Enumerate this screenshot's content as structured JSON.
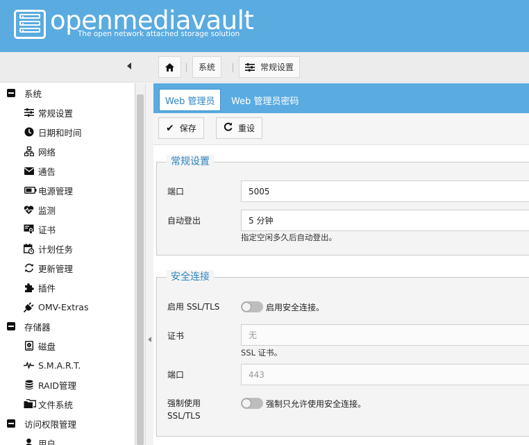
{
  "brand": {
    "name": "openmediavault",
    "tagline": "The open network attached storage solution"
  },
  "breadcrumb": {
    "items": [
      "系统",
      "常规设置"
    ]
  },
  "sidebar": {
    "groups": [
      {
        "label": "系统",
        "items": [
          {
            "label": "常规设置",
            "icon": "sliders-icon"
          },
          {
            "label": "日期和时间",
            "icon": "clock-icon"
          },
          {
            "label": "网络",
            "icon": "network-icon"
          },
          {
            "label": "通告",
            "icon": "mail-icon"
          },
          {
            "label": "电源管理",
            "icon": "battery-icon"
          },
          {
            "label": "监测",
            "icon": "heartbeat-icon"
          },
          {
            "label": "证书",
            "icon": "certificate-icon"
          },
          {
            "label": "计划任务",
            "icon": "calendar-clock-icon"
          },
          {
            "label": "更新管理",
            "icon": "refresh-icon"
          },
          {
            "label": "插件",
            "icon": "puzzle-icon"
          },
          {
            "label": "OMV-Extras",
            "icon": "plug-icon"
          }
        ]
      },
      {
        "label": "存储器",
        "items": [
          {
            "label": "磁盘",
            "icon": "harddisk-icon"
          },
          {
            "label": "S.M.A.R.T.",
            "icon": "pulse-icon"
          },
          {
            "label": "RAID管理",
            "icon": "database-icon"
          },
          {
            "label": "文件系统",
            "icon": "folders-icon"
          }
        ]
      },
      {
        "label": "访问权限管理",
        "items": [
          {
            "label": "用户",
            "icon": "user-icon"
          }
        ]
      }
    ]
  },
  "tabs": [
    {
      "label": "Web 管理员",
      "active": true
    },
    {
      "label": "Web 管理员密码",
      "active": false
    }
  ],
  "toolbar": {
    "save_label": "保存",
    "reset_label": "重设"
  },
  "general": {
    "legend": "常规设置",
    "port_label": "端口",
    "port_value": "5005",
    "autologout_label": "自动登出",
    "autologout_value": "5 分钟",
    "autologout_hint": "指定空闲多久后自动登出。"
  },
  "secure": {
    "legend": "安全连接",
    "ssl_label": "启用 SSL/TLS",
    "ssl_toggle_label": "启用安全连接。",
    "ssl_enabled": false,
    "cert_label": "证书",
    "cert_value": "无",
    "cert_hint": "SSL 证书。",
    "port_label": "端口",
    "port_value": "443",
    "force_label_1": "强制使用",
    "force_label_2": "SSL/TLS",
    "force_toggle_label": "强制只允许使用安全连接。",
    "force_enabled": false
  },
  "colors": {
    "accent": "#5aabe0",
    "link": "#2e86c1"
  }
}
